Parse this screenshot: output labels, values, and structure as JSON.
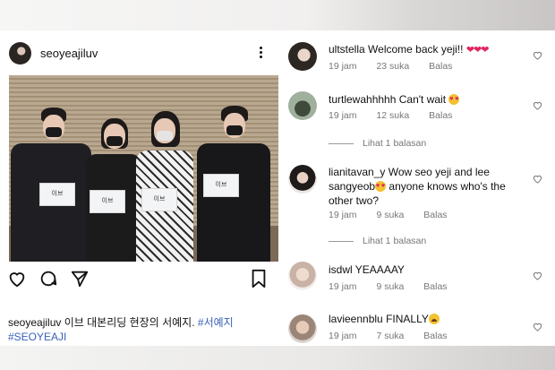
{
  "post": {
    "username": "seoyeajiluv",
    "caption_username": "seoyeajiluv",
    "caption_text": "이브 대본리딩 현장의 서예지.",
    "hashtag_1": "#서예지",
    "hashtag_2": "#SEOYEAJI",
    "script_label": "이브",
    "icons": [
      "heart-icon",
      "comment-icon",
      "share-icon",
      "bookmark-icon",
      "more-icon"
    ]
  },
  "comments": [
    {
      "username": "ultstella",
      "text": "Welcome back yeji!!",
      "emoji": "hearts",
      "time": "19 jam",
      "likes": "23 suka",
      "reply": "Balas"
    },
    {
      "username": "turtlewahhhhh",
      "text": "Can't wait",
      "emoji": "heart-eyes",
      "time": "19 jam",
      "likes": "12 suka",
      "reply": "Balas",
      "view_replies": "Lihat 1 balasan"
    },
    {
      "username": "lianitavan_y",
      "text_1": "Wow seo yeji and lee",
      "text_2": "sangyeob",
      "text_3": "anyone knows who's the",
      "text_4": "other two?",
      "emoji": "heart-eyes",
      "time": "19 jam",
      "likes": "9 suka",
      "reply": "Balas",
      "view_replies": "Lihat 1 balasan"
    },
    {
      "username": "isdwl",
      "text": "YEAAAAY",
      "time": "19 jam",
      "likes": "9 suka",
      "reply": "Balas"
    },
    {
      "username": "lavieennblu",
      "text": "FINALLY",
      "emoji": "crying",
      "time": "19 jam",
      "likes": "7 suka",
      "reply": "Balas"
    }
  ]
}
